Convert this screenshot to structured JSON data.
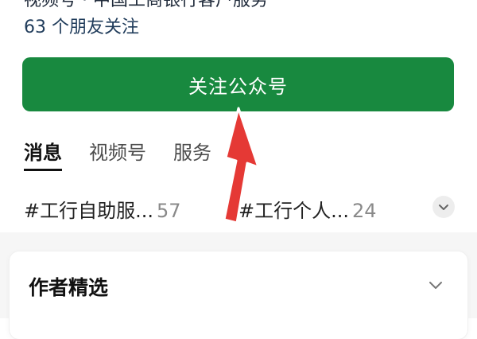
{
  "header": {
    "account_desc_clipped": "视频号 · 中国工商银行客户服务",
    "friends_following": "63 个朋友关注"
  },
  "follow_button": {
    "label": "关注公众号"
  },
  "tabs": [
    {
      "label": "消息",
      "active": true
    },
    {
      "label": "视频号",
      "active": false
    },
    {
      "label": "服务",
      "active": false
    }
  ],
  "topics": [
    {
      "label": "#工行自助服...",
      "count": "57"
    },
    {
      "label": "#工行个人...",
      "count": "24"
    }
  ],
  "author_picks": {
    "title": "作者精选"
  },
  "colors": {
    "brand_green": "#18893f",
    "annotation_red": "#e53935"
  },
  "icons": {
    "topics_expand": "chevron-down-icon",
    "card_expand": "chevron-down-icon",
    "annotation": "red-arrow-icon"
  }
}
